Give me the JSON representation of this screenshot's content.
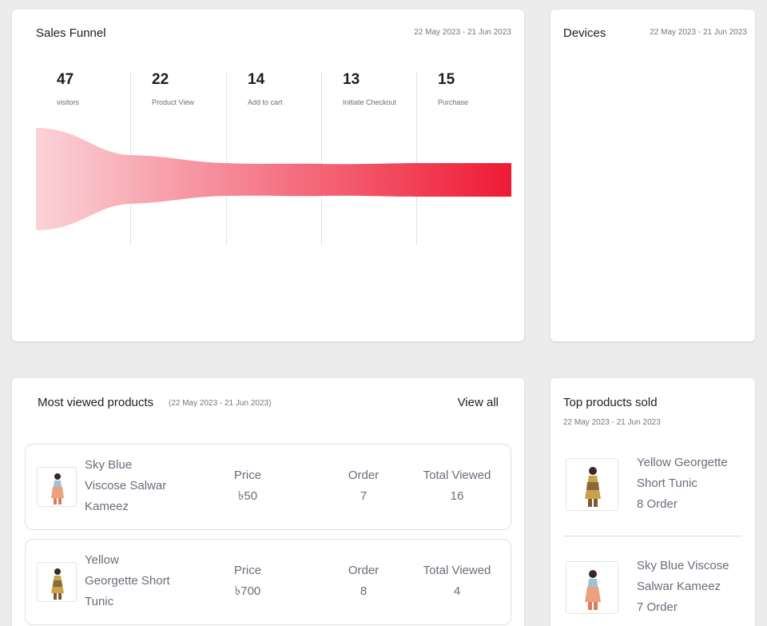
{
  "sales_funnel": {
    "title": "Sales Funnel",
    "date_range": "22 May 2023 - 21 Jun 2023",
    "stages": [
      {
        "value": "47",
        "label": "visitors"
      },
      {
        "value": "22",
        "label": "Product View"
      },
      {
        "value": "14",
        "label": "Add to cart"
      },
      {
        "value": "13",
        "label": "Initiate Checkout"
      },
      {
        "value": "15",
        "label": "Purchase"
      }
    ],
    "gradient_start": "#fbd3d8",
    "gradient_end": "#ef1a35"
  },
  "devices": {
    "title": "Devices",
    "date_range": "22 May 2023 - 21 Jun 2023"
  },
  "most_viewed": {
    "title": "Most viewed products",
    "date_range": "(22 May 2023 - 21 Jun 2023)",
    "view_all": "View all",
    "price_header": "Price",
    "order_header": "Order",
    "viewed_header": "Total Viewed",
    "products": [
      {
        "name_lines": [
          "Sky Blue",
          "Viscose Salwar",
          "Kameez"
        ],
        "price": "৳50",
        "order": "7",
        "viewed": "16"
      },
      {
        "name_lines": [
          "Yellow",
          "Georgette Short",
          "Tunic"
        ],
        "price": "৳700",
        "order": "8",
        "viewed": "4"
      }
    ]
  },
  "top_products": {
    "title": "Top products sold",
    "date_range": "22 May 2023 - 21 Jun 2023",
    "items": [
      {
        "name_lines": [
          "Yellow Georgette",
          "Short Tunic"
        ],
        "orders": "8 Order"
      },
      {
        "name_lines": [
          "Sky Blue Viscose",
          "Salwar Kameez"
        ],
        "orders": "7 Order"
      }
    ]
  }
}
